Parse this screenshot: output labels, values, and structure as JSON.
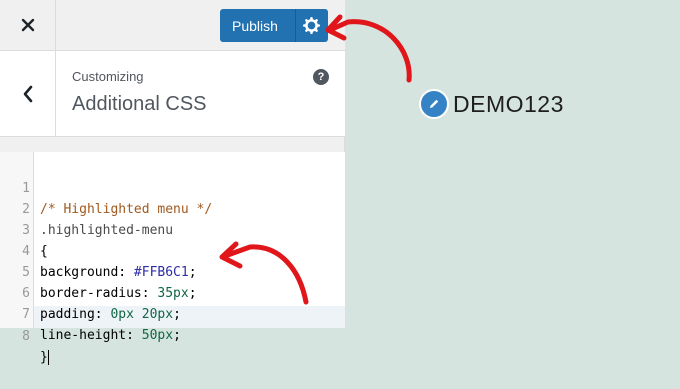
{
  "topbar": {
    "close_icon": "close-icon",
    "publish_label": "Publish",
    "settings_icon": "gear-icon"
  },
  "section": {
    "breadcrumb": "Customizing",
    "title": "Additional CSS",
    "back_icon": "chevron-left-icon",
    "help_icon": "help-icon",
    "help_glyph": "?"
  },
  "editor": {
    "line_numbers": [
      "1",
      "2",
      "3",
      "4",
      "5",
      "6",
      "7",
      "8"
    ],
    "lines": {
      "l1": "/* Highlighted menu */",
      "l2": ".highlighted-menu",
      "l3": "{",
      "l4_prop": "background: ",
      "l4_val": "#FFB6C1",
      "l4_end": ";",
      "l5_prop": "border-radius: ",
      "l5_val": "35px",
      "l5_end": ";",
      "l6_prop": "padding: ",
      "l6_val1": "0px",
      "l6_sp": " ",
      "l6_val2": "20px",
      "l6_end": ";",
      "l7_prop": "line-height: ",
      "l7_val": "50px",
      "l7_end": ";",
      "l8": "}"
    }
  },
  "preview": {
    "site_title": "DEMO123",
    "edit_icon": "pencil-icon"
  },
  "colors": {
    "accent": "#2271b1",
    "preview_bg": "#d5e4de",
    "annotation": "#e0161b"
  }
}
